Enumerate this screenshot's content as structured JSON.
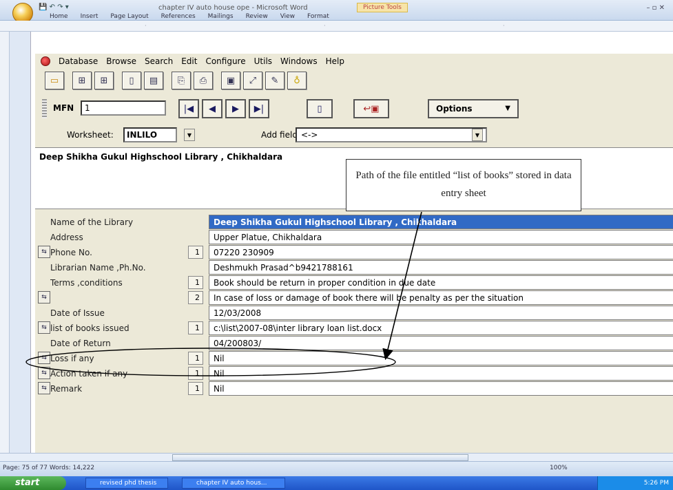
{
  "word": {
    "doc_title": "chapter IV auto house ope - Microsoft Word",
    "context_tab": "Picture Tools",
    "ribbon_tabs": [
      "Home",
      "Insert",
      "Page Layout",
      "References",
      "Mailings",
      "Review",
      "View",
      "Format"
    ],
    "status": "Page: 75 of 77   Words: 14,222",
    "zoom": "100%"
  },
  "isis": {
    "menu": [
      "Database",
      "Browse",
      "Search",
      "Edit",
      "Configure",
      "Utils",
      "Windows",
      "Help"
    ],
    "mfn_label": "MFN",
    "mfn_value": "1",
    "options_label": "Options",
    "worksheet_label": "Worksheet:",
    "worksheet_value": "INLILO",
    "addfield_label": "Add field:",
    "addfield_value": "<->",
    "heading": "Deep Shikha Gukul Highschool Library , Chikhaldara",
    "fields": [
      {
        "label": "Name of the Library",
        "num": "",
        "value": "Deep Shikha Gukul Highschool Library , Chikhaldara",
        "btn": false,
        "selected": true
      },
      {
        "label": "Address",
        "num": "",
        "value": "Upper Platue, Chikhaldara",
        "btn": false,
        "selected": false
      },
      {
        "label": "Phone No.",
        "num": "1",
        "value": "07220 230909",
        "btn": true,
        "selected": false
      },
      {
        "label": "Librarian Name ,Ph.No.",
        "num": "",
        "value": "Deshmukh Prasad^b9421788161",
        "btn": false,
        "selected": false
      },
      {
        "label": "Terms ,conditions",
        "num": "1",
        "value": "Book should be return in proper condition in due date",
        "btn": false,
        "selected": false
      },
      {
        "label": "",
        "num": "2",
        "value": "In case of loss or damage of book there will be penalty as per the situation",
        "btn": true,
        "selected": false
      },
      {
        "label": "Date of Issue",
        "num": "",
        "value": "12/03/2008",
        "btn": false,
        "selected": false
      },
      {
        "label": "list of books issued",
        "num": "1",
        "value": "c:\\list\\2007-08\\inter library loan list.docx",
        "btn": true,
        "selected": false
      },
      {
        "label": "Date of Return",
        "num": "",
        "value": "04/200803/",
        "btn": false,
        "selected": false
      },
      {
        "label": "Loss if any",
        "num": "1",
        "value": "Nil",
        "btn": true,
        "selected": false
      },
      {
        "label": "Action taken if any",
        "num": "1",
        "value": "Nil",
        "btn": true,
        "selected": false
      },
      {
        "label": "Remark",
        "num": "1",
        "value": "Nil",
        "btn": true,
        "selected": false
      }
    ]
  },
  "annotation": {
    "callout_text": "Path of the file entitled “list of books” stored in data entry sheet"
  },
  "taskbar": {
    "start": "start",
    "tasks": [
      "revised phd thesis",
      "chapter IV auto hous..."
    ],
    "clock": "5:26 PM"
  }
}
